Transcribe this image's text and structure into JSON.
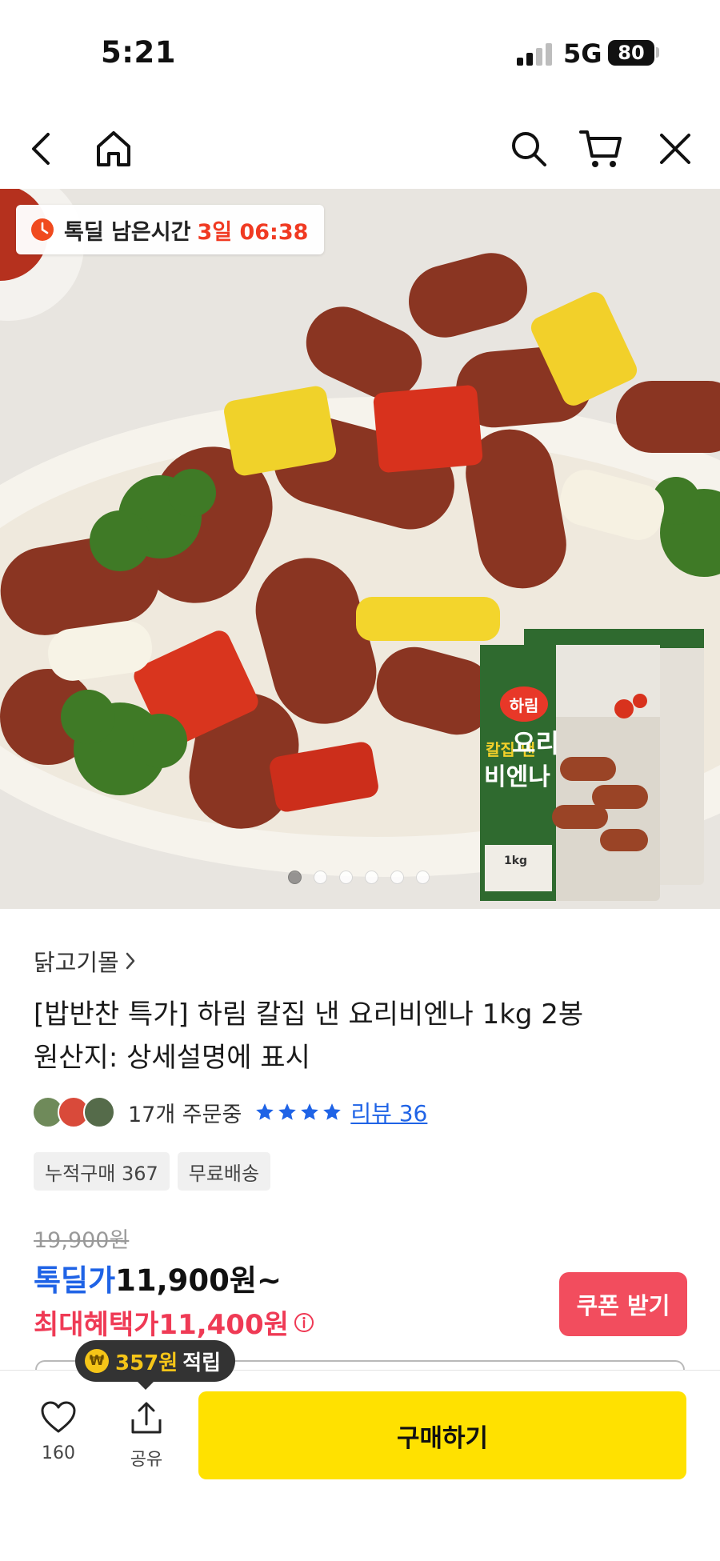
{
  "status_bar": {
    "time": "5:21",
    "network": "5G",
    "battery": "80"
  },
  "nav": {
    "icons": [
      "back-icon",
      "home-icon",
      "search-icon",
      "cart-icon",
      "close-icon"
    ]
  },
  "hero": {
    "timer_label": "톡딜 남은시간",
    "timer_value": "3일 06:38",
    "slide_count": 6,
    "active_slide": 1,
    "package_brand": "하림",
    "package_name_small": "칼집 낸",
    "package_name_1": "요리",
    "package_name_2": "비엔나",
    "package_weight": "1kg"
  },
  "product": {
    "store": "닭고기몰",
    "title_line1": "[밥반찬 특가] 하림 칼집 낸 요리비엔나 1kg 2봉",
    "title_line2": "원산지: 상세설명에 표시",
    "order_count": "17개 주문중",
    "rating_stars": 4,
    "review_link": "리뷰 36",
    "chips": [
      "누적구매 367",
      "무료배송"
    ]
  },
  "pricing": {
    "original_price": "19,900원",
    "deal_label": "톡딜가",
    "deal_price": "11,900원~",
    "max_benefit_label": "최대혜택가",
    "max_benefit_price": "11,400원",
    "coupon_button": "쿠폰 받기"
  },
  "bottom_bar": {
    "points_coin": "₩",
    "points_amount": "357원",
    "points_text": "적립",
    "like_count": "160",
    "share_label": "공유",
    "buy_button": "구매하기"
  },
  "colors": {
    "accent_blue": "#1f63e6",
    "accent_red": "#ef3a55",
    "timer_red": "#f03a22",
    "buy_yellow": "#ffe100",
    "coupon_pink": "#f24d5e"
  }
}
